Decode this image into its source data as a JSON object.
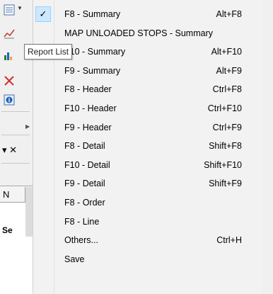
{
  "tooltip": {
    "text": "Report List"
  },
  "side": {
    "column_header": "N",
    "row_label": "Se"
  },
  "menu": {
    "items": [
      {
        "label": "F8 - Summary",
        "shortcut": "Alt+F8",
        "checked": true
      },
      {
        "label": "MAP UNLOADED STOPS - Summary",
        "shortcut": ""
      },
      {
        "label": "F10 - Summary",
        "shortcut": "Alt+F10"
      },
      {
        "label": "F9 - Summary",
        "shortcut": "Alt+F9"
      },
      {
        "label": "F8 - Header",
        "shortcut": "Ctrl+F8"
      },
      {
        "label": "F10 - Header",
        "shortcut": "Ctrl+F10"
      },
      {
        "label": "F9 - Header",
        "shortcut": "Ctrl+F9"
      },
      {
        "label": "F8 - Detail",
        "shortcut": "Shift+F8"
      },
      {
        "label": "F10 - Detail",
        "shortcut": "Shift+F10"
      },
      {
        "label": "F9 - Detail",
        "shortcut": "Shift+F9"
      },
      {
        "label": "F8 - Order",
        "shortcut": ""
      },
      {
        "label": "F8 - Line",
        "shortcut": ""
      },
      {
        "label": "Others...",
        "shortcut": "Ctrl+H"
      },
      {
        "label": "Save",
        "shortcut": ""
      }
    ]
  },
  "colors": {
    "check_bg": "#cce8ff",
    "check_border": "#99d1ff",
    "close_red": "#d32f2f"
  }
}
